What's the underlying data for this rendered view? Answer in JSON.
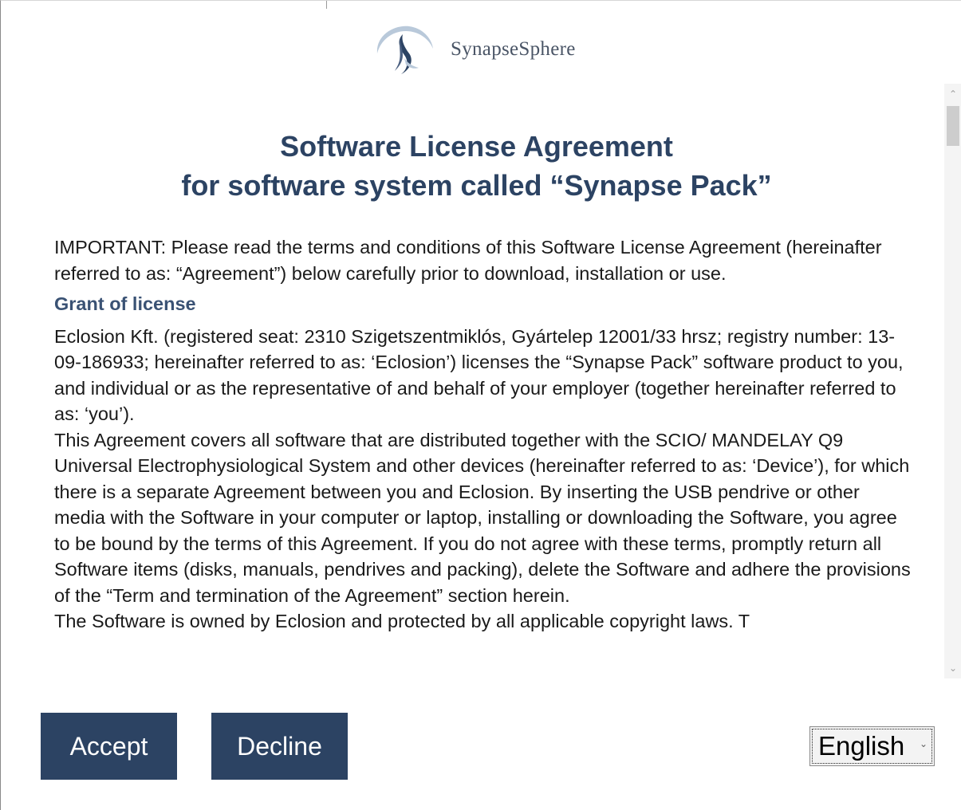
{
  "brand": {
    "name": "SynapseSphere",
    "accent_color": "#2c4363"
  },
  "title": {
    "line1": "Software License Agreement",
    "line2": "for software system called “Synapse Pack”"
  },
  "intro": "IMPORTANT: Please read the terms and conditions of this Software License Agreement (hereinafter referred to as: “Agreement”) below carefully prior to download, installation or use.",
  "section_heading": "Grant of license",
  "paragraphs": [
    "Eclosion Kft. (registered seat: 2310 Szigetszentmiklós, Gyártelep 12001/33 hrsz; registry number: 13-09-186933; hereinafter referred to as: ‘Eclosion’) licenses the “Synapse Pack” software product to you, and individual or as the representative of and behalf of your employer (together hereinafter referred to as: ‘you’).",
    "This Agreement covers all software that are distributed together with the SCIO/ MANDELAY Q9 Universal Electrophysiological System and other devices (hereinafter referred to as: ‘Device’), for which there is a separate Agreement between you and Eclosion. By inserting the USB pendrive or other media with the Software in your computer or laptop, installing or downloading the Software, you agree to be bound by the terms of this Agreement. If you do not agree with these terms, promptly return all Software items (disks, manuals, pendrives and packing), delete the Software and adhere the provisions of the “Term and termination of the Agreement” section herein.",
    "The Software is owned by Eclosion and protected by all applicable copyright laws. T"
  ],
  "buttons": {
    "accept": "Accept",
    "decline": "Decline"
  },
  "language": {
    "selected": "English"
  },
  "icons": {
    "logo": "synapsesphere-logo-icon",
    "scroll_up": "chevron-up-icon",
    "scroll_down": "chevron-down-icon",
    "language_dropdown": "chevron-down-icon"
  }
}
